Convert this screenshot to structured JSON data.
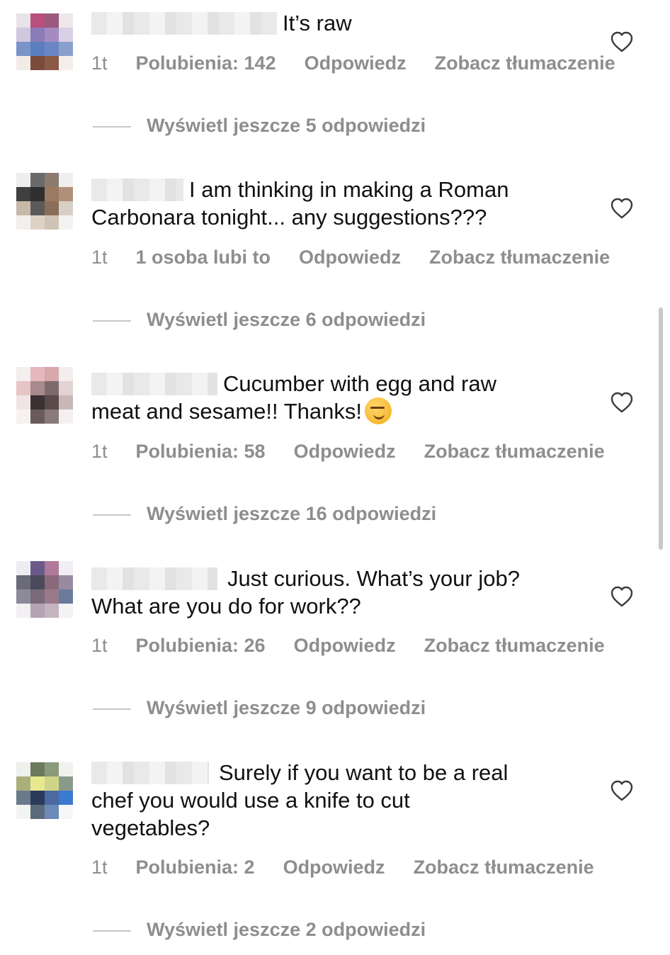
{
  "comments": [
    {
      "text": "It’s raw",
      "time": "1t",
      "likes": "Polubienia: 142",
      "reply": "Odpowiedz",
      "translate": "Zobacz tłumaczenie",
      "more_replies": "Wyświetl jeszcze 5 odpowiedzi"
    },
    {
      "text_line1": "I am thinking in making a Roman",
      "text_line2": "Carbonara tonight... any suggestions???",
      "time": "1t",
      "likes": "1 osoba lubi to",
      "reply": "Odpowiedz",
      "translate": "Zobacz tłumaczenie",
      "more_replies": "Wyświetl jeszcze 6 odpowiedzi"
    },
    {
      "text_line1": "Cucumber with egg and raw",
      "text_line2": "meat and sesame!! Thanks!",
      "emoji": "smirking-face",
      "time": "1t",
      "likes": "Polubienia: 58",
      "reply": "Odpowiedz",
      "translate": "Zobacz tłumaczenie",
      "more_replies": "Wyświetl jeszcze 16 odpowiedzi"
    },
    {
      "text_line1": "Just curious. What’s your job?",
      "text_line2": "What are you do for work??",
      "time": "1t",
      "likes": "Polubienia: 26",
      "reply": "Odpowiedz",
      "translate": "Zobacz tłumaczenie",
      "more_replies": "Wyświetl jeszcze 9 odpowiedzi"
    },
    {
      "text_line1": "Surely if you want to be a real",
      "text_line2": "chef you would use a knife to cut",
      "text_line3": "vegetables?",
      "time": "1t",
      "likes": "Polubienia: 2",
      "reply": "Odpowiedz",
      "translate": "Zobacz tłumaczenie",
      "more_replies": "Wyświetl jeszcze 2 odpowiedzi"
    }
  ],
  "icons": {
    "like": "heart-outline-icon"
  },
  "colors": {
    "meta_text": "#8e8e8e",
    "body_text": "#111111",
    "background": "#ffffff"
  }
}
